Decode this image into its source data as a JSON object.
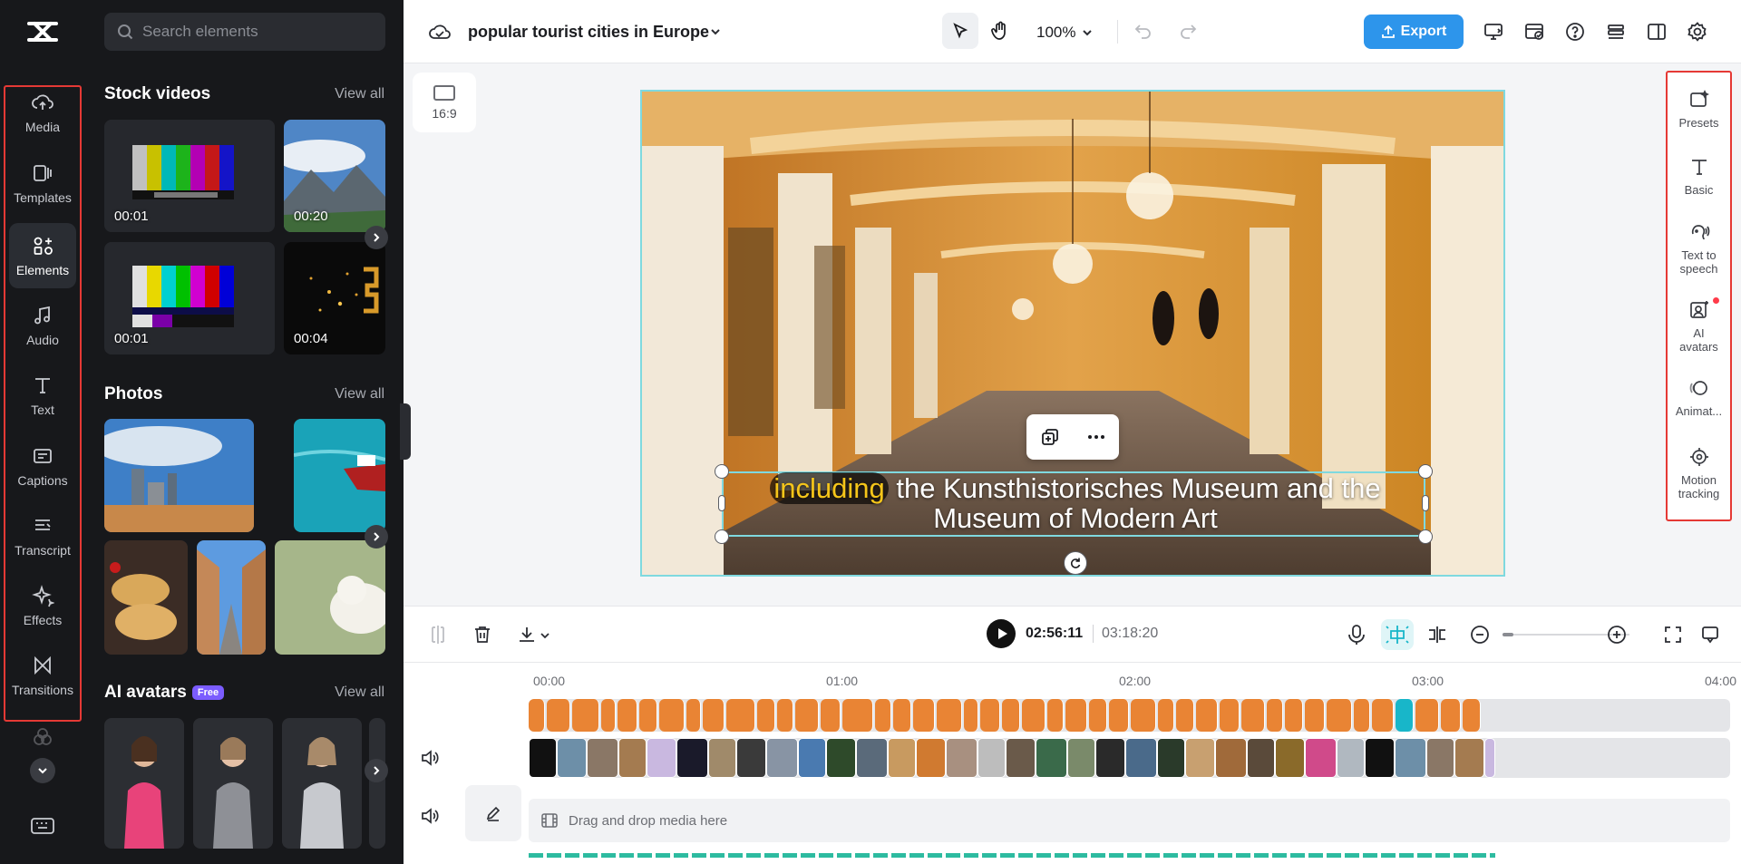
{
  "left_rail": {
    "items": [
      {
        "label": "Media",
        "icon": "cloud-upload-icon"
      },
      {
        "label": "Templates",
        "icon": "templates-icon"
      },
      {
        "label": "Elements",
        "icon": "elements-icon",
        "active": true
      },
      {
        "label": "Audio",
        "icon": "music-note-icon"
      },
      {
        "label": "Text",
        "icon": "text-icon"
      },
      {
        "label": "Captions",
        "icon": "captions-icon"
      },
      {
        "label": "Transcript",
        "icon": "transcript-icon"
      },
      {
        "label": "Effects",
        "icon": "effects-sparkle-icon"
      },
      {
        "label": "Transitions",
        "icon": "transitions-icon"
      }
    ]
  },
  "panel": {
    "search_placeholder": "Search elements",
    "stock_videos": {
      "title": "Stock videos",
      "view_all": "View all",
      "items": [
        {
          "duration": "00:01",
          "type": "color-bars"
        },
        {
          "duration": "00:20",
          "type": "mountains"
        },
        {
          "duration": "00:01",
          "type": "color-bars"
        },
        {
          "duration": "00:04",
          "type": "sparkles"
        }
      ]
    },
    "photos": {
      "title": "Photos",
      "view_all": "View all"
    },
    "ai_avatars": {
      "title": "AI avatars",
      "badge": "Free",
      "view_all": "View all"
    }
  },
  "topbar": {
    "project_title": "popular tourist cities in Europe",
    "zoom": "100%",
    "export_label": "Export"
  },
  "canvas": {
    "aspect_ratio": "16:9",
    "caption_highlight": "including",
    "caption_line1_rest": " the Kunsthistorisches Museum and the",
    "caption_line2": "Museum of Modern Art"
  },
  "right_panel": {
    "items": [
      {
        "label": "Presets",
        "icon": "presets-icon"
      },
      {
        "label": "Basic",
        "icon": "text-basic-icon"
      },
      {
        "label": "Text to speech",
        "icon": "text-to-speech-icon"
      },
      {
        "label": "AI avatars",
        "icon": "ai-avatar-icon",
        "notification": true
      },
      {
        "label": "Animat...",
        "icon": "animation-icon"
      },
      {
        "label": "Motion tracking",
        "icon": "motion-tracking-icon"
      }
    ]
  },
  "timeline": {
    "current_time": "02:56:11",
    "total_time": "03:18:20",
    "ruler": [
      "00:00",
      "01:00",
      "02:00",
      "03:00",
      "04:00"
    ],
    "drop_zone_text": "Drag and drop media here"
  },
  "colors": {
    "accent_export": "#2d95eb",
    "caption_clip": "#e98434",
    "selection": "#7fd9df",
    "highlight_red": "#e53935",
    "caption_highlight": "#f5c51a"
  }
}
